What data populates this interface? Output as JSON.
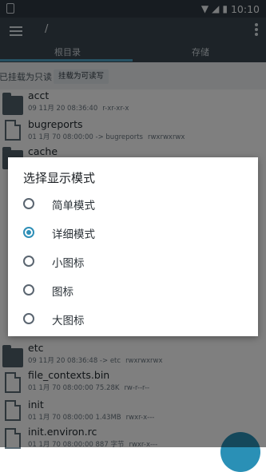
{
  "status_bar": {
    "time": "10:10"
  },
  "toolbar": {
    "path": "/",
    "tabs": [
      "根目录",
      "存储"
    ]
  },
  "mount": {
    "label": "已挂载为只读",
    "button": "挂载为可读写"
  },
  "files": [
    {
      "name": "acct",
      "type": "folder",
      "meta": "09 11月 20 08:36:40",
      "perm": "r-xr-xr-x"
    },
    {
      "name": "bugreports",
      "type": "file",
      "meta": "01 1月 70 08:00:00 -> bugreports",
      "perm": "rwxrwxrwx"
    },
    {
      "name": "cache",
      "type": "folder",
      "meta": "",
      "perm": ""
    },
    {
      "name": "etc",
      "type": "folder",
      "meta": "09 11月 20 08:36:48 -> etc",
      "perm": "rwxrwxrwx"
    },
    {
      "name": "file_contexts.bin",
      "type": "file",
      "meta": "01 1月 70 08:00:00 75.28K",
      "perm": "rw-r--r--"
    },
    {
      "name": "init",
      "type": "file",
      "meta": "01 1月 70 08:00:00 1.43MB",
      "perm": "rwxr-x---"
    },
    {
      "name": "init.environ.rc",
      "type": "file",
      "meta": "01 1月 70 08:00:00 887 字节",
      "perm": "rwxr-x---"
    }
  ],
  "dialog": {
    "title": "选择显示模式",
    "options": [
      "简单模式",
      "详细模式",
      "小图标",
      "图标",
      "大图标"
    ],
    "selected_index": 1
  },
  "colors": {
    "accent": "#2e8fb7",
    "toolbar": "#3a4650",
    "statusbar": "#2e3943"
  }
}
